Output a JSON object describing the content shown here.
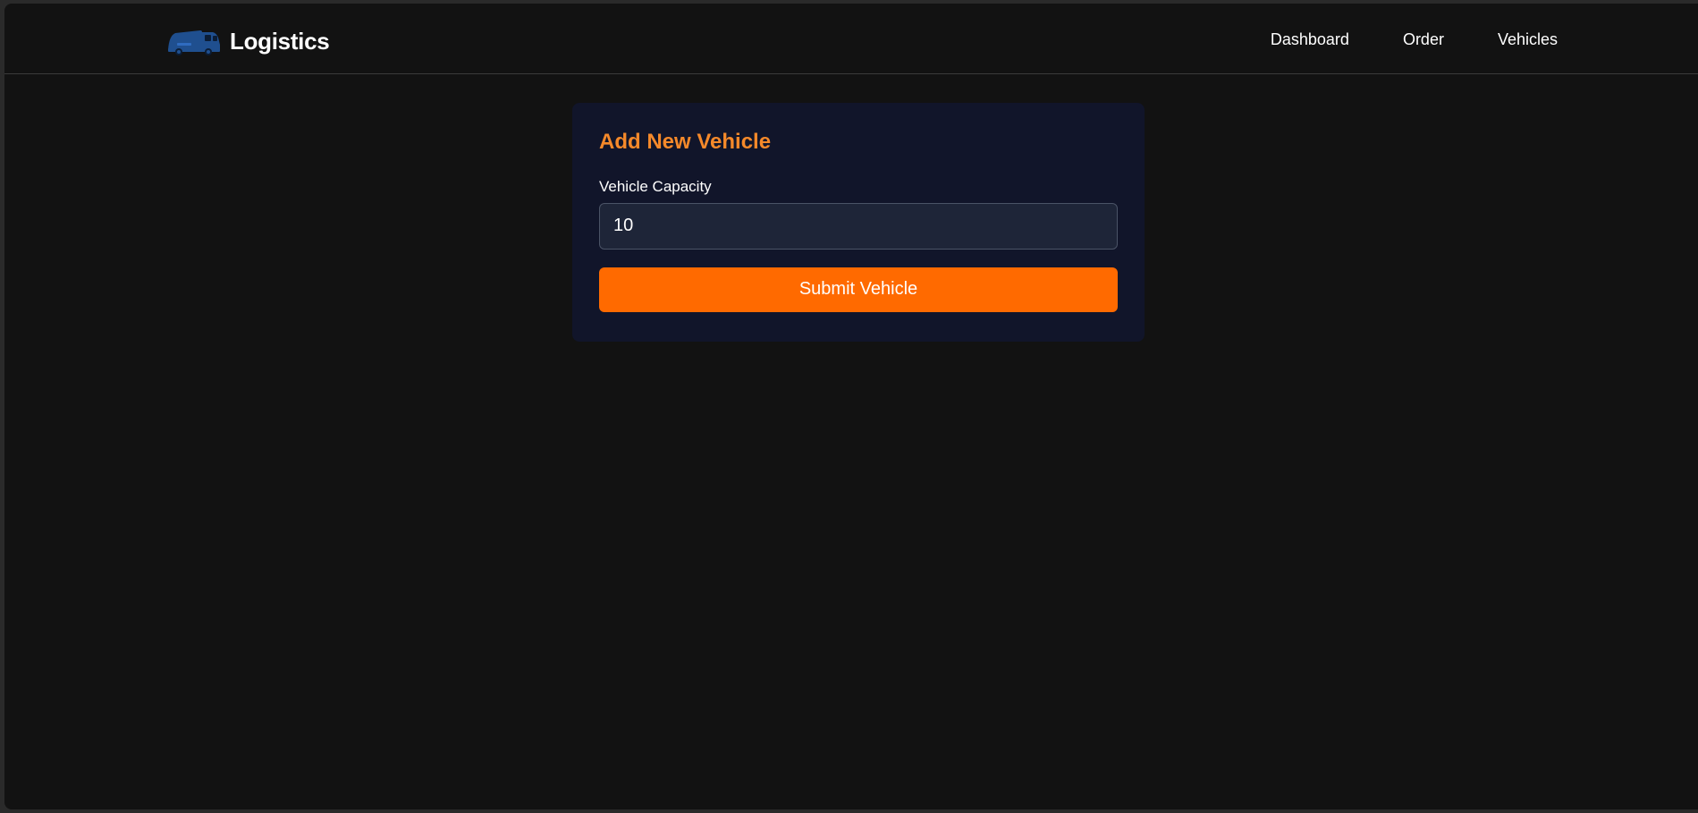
{
  "navbar": {
    "brand_name": "Logistics",
    "logo_icon": "truck-icon",
    "links": [
      {
        "label": "Dashboard"
      },
      {
        "label": "Order"
      },
      {
        "label": "Vehicles"
      }
    ]
  },
  "form": {
    "title": "Add New Vehicle",
    "capacity_label": "Vehicle Capacity",
    "capacity_value": "10",
    "submit_label": "Submit Vehicle"
  },
  "colors": {
    "background": "#121212",
    "card": "#11152a",
    "accent_title": "#f5892a",
    "button": "#ff6a00",
    "input_bg": "#1e2538",
    "logo_blue": "#1f4f8f"
  }
}
